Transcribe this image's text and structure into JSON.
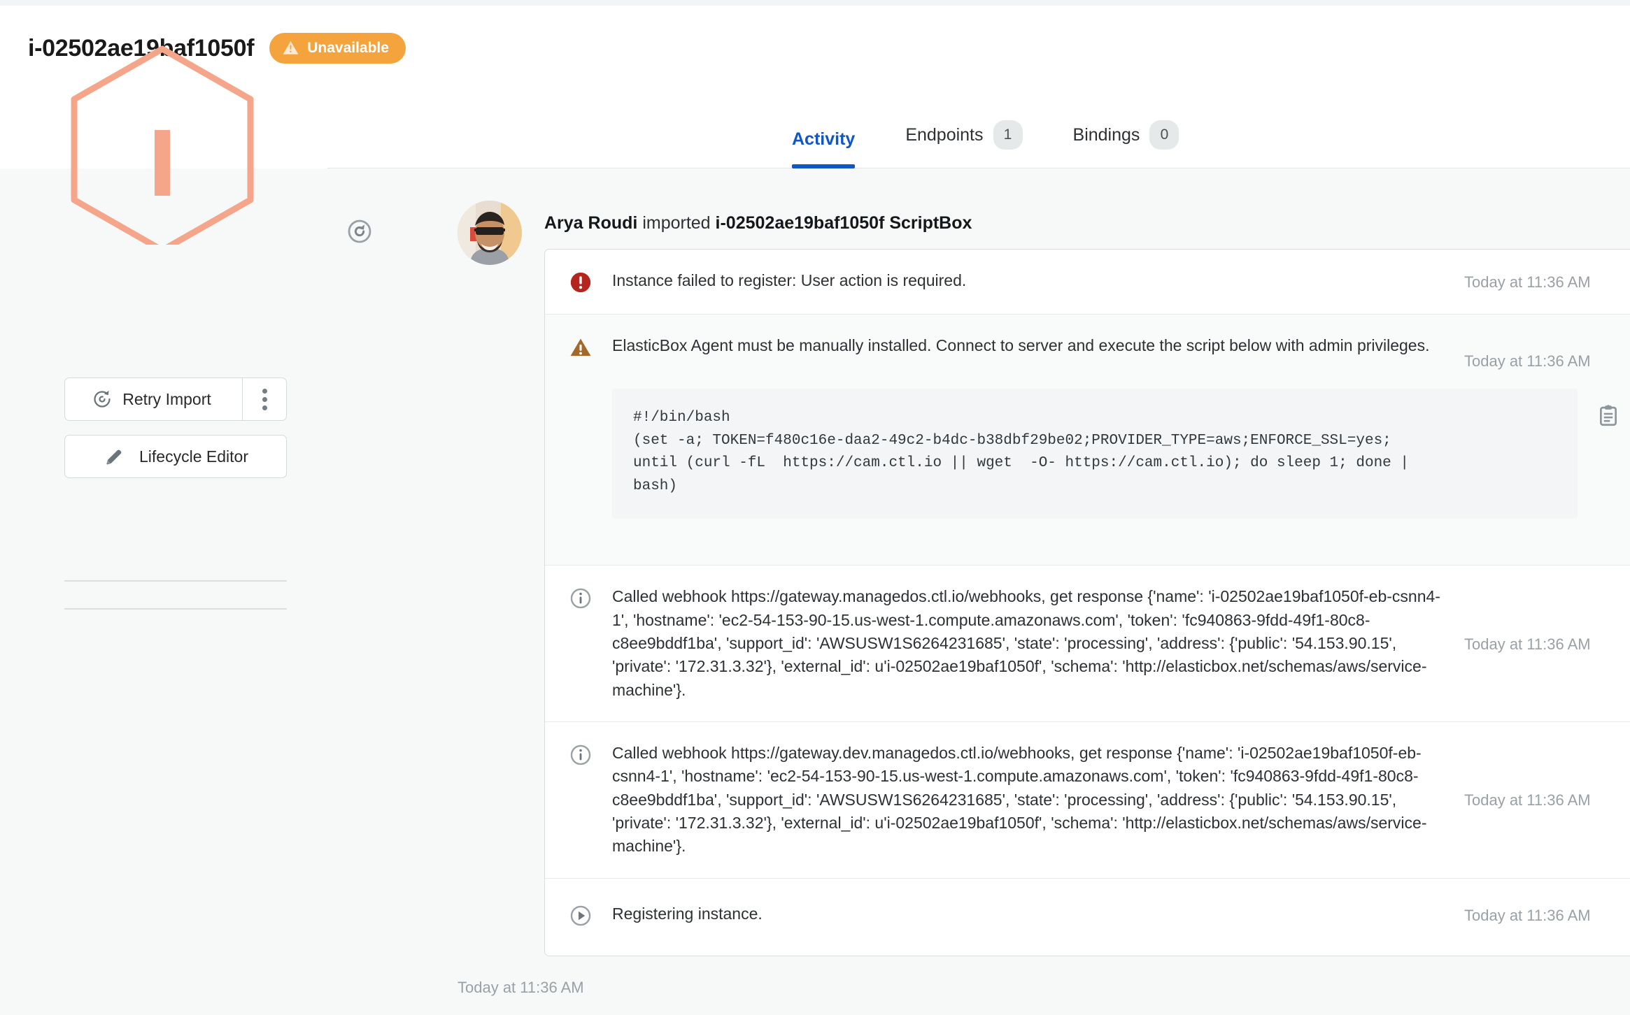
{
  "header": {
    "title": "i-02502ae19baf1050f",
    "status_badge": {
      "label": "Unavailable",
      "icon": "warning-triangle-icon",
      "color": "#f5a33c"
    }
  },
  "sidebar": {
    "logo": {
      "letter": "I",
      "shape": "hexagon-outline",
      "color": "#f5a68a"
    },
    "buttons": [
      {
        "label": "Retry Import",
        "icon": "refresh-circle-icon",
        "menu_icon": "kebab-menu-icon"
      },
      {
        "label": "Lifecycle Editor",
        "icon": "pencil-icon"
      }
    ]
  },
  "tabs": [
    {
      "label": "Activity",
      "count": null,
      "active": true
    },
    {
      "label": "Endpoints",
      "count": "1",
      "active": false
    },
    {
      "label": "Bindings",
      "count": "0",
      "active": false
    }
  ],
  "activity": {
    "gutter_icon": "refresh-circle-icon",
    "avatar": "user-avatar",
    "author": "Arya Roudi",
    "action": "imported",
    "resource": "i-02502ae19baf1050f ScriptBox",
    "footer_time": "Today at 11:36 AM",
    "entries": [
      {
        "icon": "error-circle-icon",
        "text": "Instance failed to register: User action is required.",
        "time": "Today at 11:36 AM"
      },
      {
        "icon": "warning-triangle-icon",
        "text": "ElasticBox Agent must be manually installed. Connect to server and execute the script below with admin privileges.",
        "time": "Today at 11:36 AM",
        "code": "#!/bin/bash\n(set -a; TOKEN=f480c16e-daa2-49c2-b4dc-b38dbf29be02;PROVIDER_TYPE=aws;ENFORCE_SSL=yes;\nuntil (curl -fL  https://cam.ctl.io || wget  -O- https://cam.ctl.io); do sleep 1; done |\nbash)",
        "copy_icon": "clipboard-copy-icon"
      },
      {
        "icon": "info-circle-icon",
        "text": "Called webhook https://gateway.managedos.ctl.io/webhooks, get response {'name': 'i-02502ae19baf1050f-eb-csnn4-1', 'hostname': 'ec2-54-153-90-15.us-west-1.compute.amazonaws.com', 'token': 'fc940863-9fdd-49f1-80c8-c8ee9bddf1ba', 'support_id': 'AWSUSW1S6264231685', 'state': 'processing', 'address': {'public': '54.153.90.15', 'private': '172.31.3.32'}, 'external_id': u'i-02502ae19baf1050f', 'schema': 'http://elasticbox.net/schemas/aws/service-machine'}.",
        "time": "Today at 11:36 AM"
      },
      {
        "icon": "info-circle-icon",
        "text": "Called webhook https://gateway.dev.managedos.ctl.io/webhooks, get response {'name': 'i-02502ae19baf1050f-eb-csnn4-1', 'hostname': 'ec2-54-153-90-15.us-west-1.compute.amazonaws.com', 'token': 'fc940863-9fdd-49f1-80c8-c8ee9bddf1ba', 'support_id': 'AWSUSW1S6264231685', 'state': 'processing', 'address': {'public': '54.153.90.15', 'private': '172.31.3.32'}, 'external_id': u'i-02502ae19baf1050f', 'schema': 'http://elasticbox.net/schemas/aws/service-machine'}.",
        "time": "Today at 11:36 AM"
      },
      {
        "icon": "play-circle-icon",
        "text": "Registering instance.",
        "time": "Today at 11:36 AM"
      }
    ]
  }
}
